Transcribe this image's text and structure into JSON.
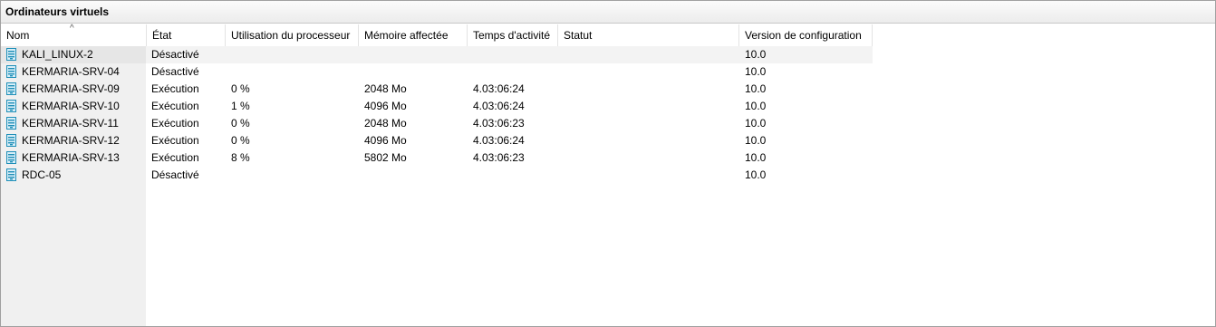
{
  "panel": {
    "title": "Ordinateurs virtuels"
  },
  "columns": {
    "name": "Nom",
    "state": "État",
    "cpu": "Utilisation du processeur",
    "memory": "Mémoire affectée",
    "uptime": "Temps d'activité",
    "status": "Statut",
    "config_version": "Version de configuration"
  },
  "sort": {
    "column": "name",
    "direction": "ascending",
    "indicator": "^"
  },
  "selected_row": 0,
  "rows": [
    {
      "name": "KALI_LINUX-2",
      "state": "Désactivé",
      "cpu": "",
      "memory": "",
      "uptime": "",
      "status": "",
      "config_version": "10.0"
    },
    {
      "name": "KERMARIA-SRV-04",
      "state": "Désactivé",
      "cpu": "",
      "memory": "",
      "uptime": "",
      "status": "",
      "config_version": "10.0"
    },
    {
      "name": "KERMARIA-SRV-09",
      "state": "Exécution",
      "cpu": "0 %",
      "memory": "2048 Mo",
      "uptime": "4.03:06:24",
      "status": "",
      "config_version": "10.0"
    },
    {
      "name": "KERMARIA-SRV-10",
      "state": "Exécution",
      "cpu": "1 %",
      "memory": "4096 Mo",
      "uptime": "4.03:06:24",
      "status": "",
      "config_version": "10.0"
    },
    {
      "name": "KERMARIA-SRV-11",
      "state": "Exécution",
      "cpu": "0 %",
      "memory": "2048 Mo",
      "uptime": "4.03:06:23",
      "status": "",
      "config_version": "10.0"
    },
    {
      "name": "KERMARIA-SRV-12",
      "state": "Exécution",
      "cpu": "0 %",
      "memory": "4096 Mo",
      "uptime": "4.03:06:24",
      "status": "",
      "config_version": "10.0"
    },
    {
      "name": "KERMARIA-SRV-13",
      "state": "Exécution",
      "cpu": "8 %",
      "memory": "5802 Mo",
      "uptime": "4.03:06:23",
      "status": "",
      "config_version": "10.0"
    },
    {
      "name": "RDC-05",
      "state": "Désactivé",
      "cpu": "",
      "memory": "",
      "uptime": "",
      "status": "",
      "config_version": "10.0"
    }
  ],
  "icons": {
    "vm": "virtual-machine-icon",
    "sort": "sort-ascending-icon"
  },
  "colors": {
    "vm_icon": "#1f8fb8",
    "selected_row": "#f3f3f3"
  }
}
